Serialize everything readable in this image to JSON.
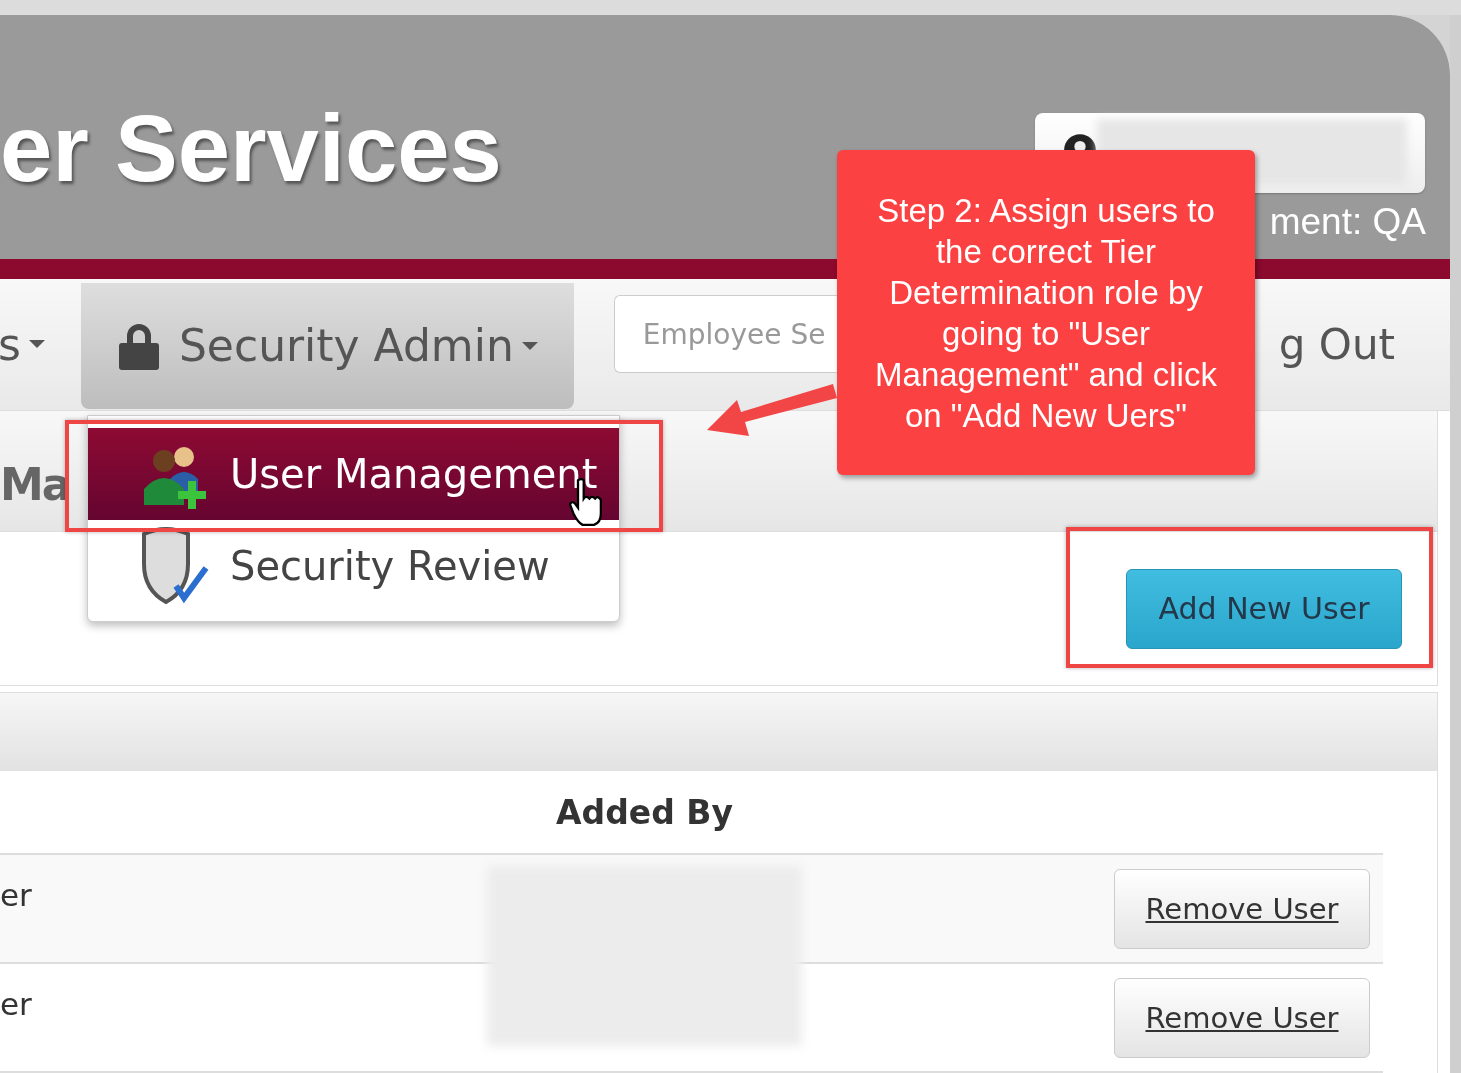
{
  "header": {
    "title": "er Services",
    "environment": "ment: QA"
  },
  "nav": {
    "items": [
      {
        "label": "s",
        "kind": "dropdown",
        "selected": false
      },
      {
        "label": "Security Admin",
        "kind": "dropdown",
        "selected": true
      }
    ],
    "search": {
      "placeholder": "Employee Se"
    },
    "logout": "g Out"
  },
  "dropdown": {
    "items": [
      {
        "label": "User Management",
        "selected": true
      },
      {
        "label": "Security Review",
        "selected": false
      }
    ]
  },
  "page": {
    "heading": "Ma",
    "add_button": "Add New User"
  },
  "table": {
    "column_2_heading": "Added By",
    "rows": [
      {
        "column_1": "er",
        "action": "Remove User"
      },
      {
        "column_1": "er",
        "action": "Remove User"
      }
    ]
  },
  "annotation": {
    "text": "Step 2: Assign users to the correct Tier Determination role by going to \"User Management\" and click on \"Add New Uers\""
  }
}
